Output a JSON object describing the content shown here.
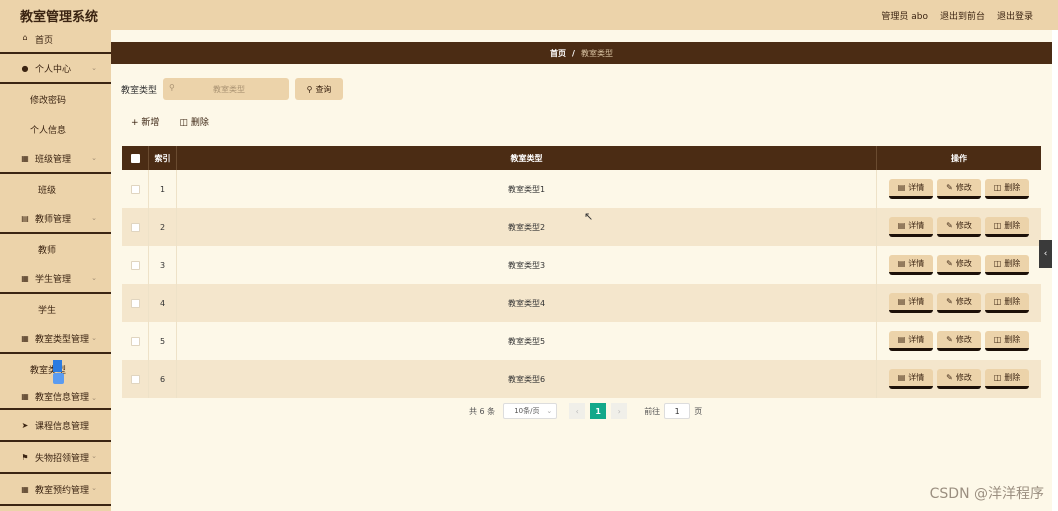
{
  "header": {
    "title": "教室管理系统",
    "admin_label": "管理员 abo",
    "back_to_front": "退出到前台",
    "logout": "退出登录"
  },
  "sidebar": {
    "home": "首页",
    "groups": [
      {
        "label": "个人中心",
        "icon": "user-icon",
        "children": [
          "修改密码",
          "个人信息"
        ]
      },
      {
        "label": "班级管理",
        "icon": "grid-icon",
        "children": [
          "班级"
        ]
      },
      {
        "label": "教师管理",
        "icon": "doc-icon",
        "children": [
          "教师"
        ]
      },
      {
        "label": "学生管理",
        "icon": "grid-icon",
        "children": [
          "学生"
        ]
      },
      {
        "label": "教室类型管理",
        "icon": "grid-icon",
        "children": [
          "教室类型"
        ]
      },
      {
        "label": "教室信息管理",
        "icon": "grid-icon",
        "children": []
      },
      {
        "label": "课程信息管理",
        "icon": "send-icon",
        "children": []
      },
      {
        "label": "失物招领管理",
        "icon": "flag-icon",
        "children": []
      },
      {
        "label": "教室预约管理",
        "icon": "grid-icon",
        "children": []
      }
    ]
  },
  "breadcrumb": {
    "home": "首页",
    "separator": "/",
    "current": "教室类型"
  },
  "search": {
    "label": "教室类型",
    "placeholder": "教室类型",
    "query_button": "查询"
  },
  "actions": {
    "add": "新增",
    "delete": "删除"
  },
  "table": {
    "headers": {
      "index": "索引",
      "type": "教室类型",
      "operation": "操作"
    },
    "rows": [
      {
        "index": "1",
        "type": "教室类型1"
      },
      {
        "index": "2",
        "type": "教室类型2"
      },
      {
        "index": "3",
        "type": "教室类型3"
      },
      {
        "index": "4",
        "type": "教室类型4"
      },
      {
        "index": "5",
        "type": "教室类型5"
      },
      {
        "index": "6",
        "type": "教室类型6"
      }
    ],
    "row_buttons": {
      "detail": "详情",
      "edit": "修改",
      "delete": "删除"
    }
  },
  "pagination": {
    "total": "共 6 条",
    "page_size": "10条/页",
    "current_page": "1",
    "goto_label": "前往",
    "goto_value": "1",
    "page_suffix": "页"
  },
  "watermark": "CSDN @洋洋程序",
  "colors": {
    "accent": "#ecd3aa",
    "dark": "#4b2c14",
    "page_active": "#13a88a"
  }
}
